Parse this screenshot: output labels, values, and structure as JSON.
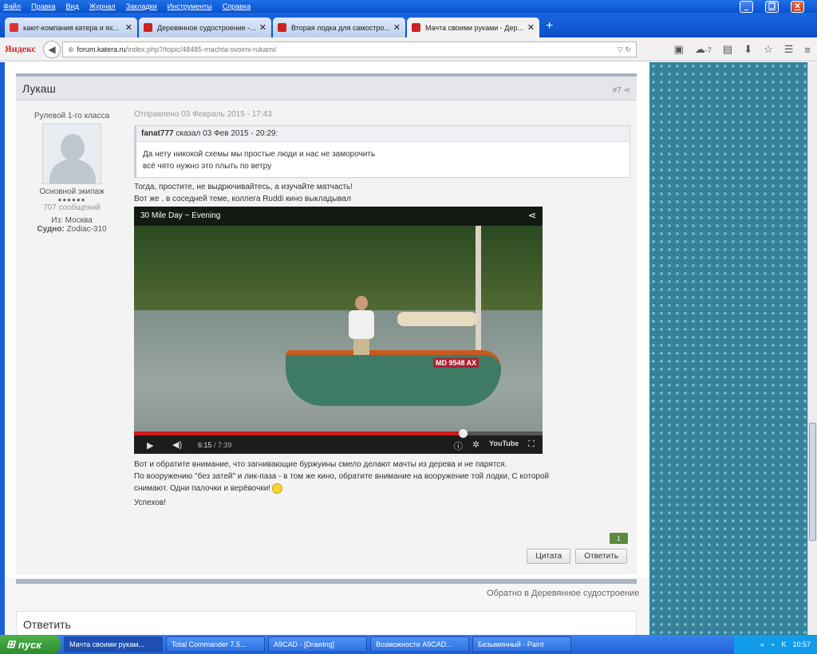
{
  "menu": [
    "Файл",
    "Правка",
    "Вид",
    "Журнал",
    "Закладки",
    "Инструменты",
    "Справка"
  ],
  "tabs": [
    {
      "label": "кают-компания катера и ях...",
      "color": "#d33"
    },
    {
      "label": "Деревянное судостроение -...",
      "color": "#c22"
    },
    {
      "label": "Вторая лодка для самостро...",
      "color": "#c22"
    },
    {
      "label": "Мачта своими руками - Дер...",
      "color": "#c22"
    }
  ],
  "browser": {
    "logo": "Яндекс",
    "url_host": "forum.katera.ru",
    "url_prefix": "",
    "url_path": "/index.php?/topic/48485-machta-svoimi-rukami/",
    "weather": "-7"
  },
  "post": {
    "author": "Лукаш",
    "number": "#7",
    "rank": "Рулевой 1-го класса",
    "group": "Основной экипаж",
    "rating_dots": "●●●●●●",
    "messages": "707 сообщений",
    "from_label": "Из:",
    "from": "Москва",
    "vessel_label": "Судно:",
    "vessel": "Zodiac-310",
    "posted": "Отправлено 03 Февраль 2015 - 17:43",
    "quote": {
      "user": "fanat777",
      "said": "сказал 03 Фев 2015 - 20:29:",
      "line1": "Да нету никокой схемы мы простые люди и нас не заморочить",
      "line2": "всё чято нужно это плыть по ветру"
    },
    "line1": " Тогда, простите, не выдрючивайтесь, а изучайте матчасть!",
    "line2": "Вот же , в соседней теме, коллега Ruddi кино выкладывал",
    "video": {
      "title": "30 Mile Day ~ Evening",
      "current": "6:15",
      "duration": "/ 7:39",
      "progress": 0.805,
      "plate": "MD 9548 AX",
      "brand": "YouTube"
    },
    "line3": "Вот и обратите внимание, что загнивающие буржуины смело делают мачты из дерева и не парятся.",
    "line4": "По вооружению \"без затей\" и лик-паза - в том же кино, обратите внимание на вооружение той лодки, С которой",
    "line5": "снимают. Одни палочки и верёвочки!",
    "line6": " Успехов!",
    "reputation": "1",
    "quote_btn": "Цитата",
    "reply_btn": "Ответить"
  },
  "back_link": "Обратно в Деревянное судостроение",
  "reply_title": "Ответить",
  "taskbar": {
    "start": "пуск",
    "items": [
      "Мачта своими рукам...",
      "Total Commander 7.5...",
      "A9CAD - [Drawing]",
      "Возможности A9CAD...",
      "Безымянный - Paint"
    ],
    "lang": "RU",
    "clock": "10:57"
  }
}
